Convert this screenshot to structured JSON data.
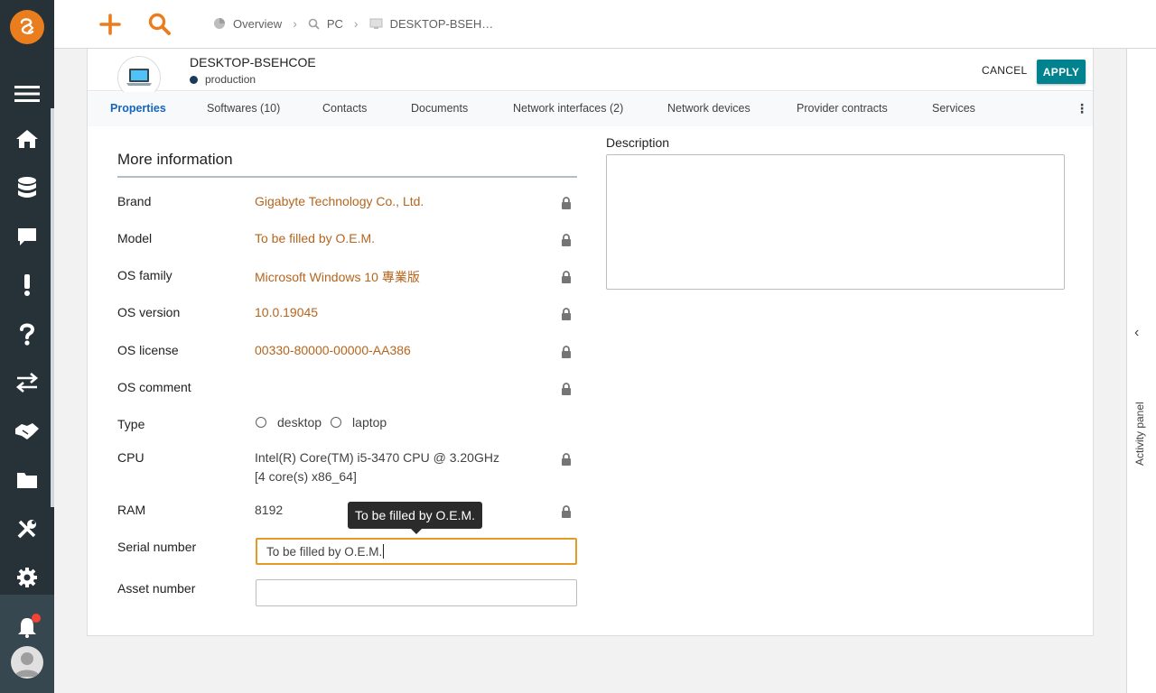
{
  "topbar": {
    "breadcrumb": [
      {
        "label": "Overview",
        "icon": "pie-chart-icon"
      },
      {
        "label": "PC",
        "icon": "search-icon"
      },
      {
        "label": "DESKTOP-BSEH…",
        "icon": "computer-icon"
      }
    ]
  },
  "object": {
    "name": "DESKTOP-BSEHCOE",
    "status": "production",
    "cancel_label": "CANCEL",
    "apply_label": "APPLY"
  },
  "tabs": [
    {
      "label": "Properties",
      "active": true
    },
    {
      "label": "Softwares (10)"
    },
    {
      "label": "Contacts"
    },
    {
      "label": "Documents"
    },
    {
      "label": "Network interfaces (2)"
    },
    {
      "label": "Network devices"
    },
    {
      "label": "Provider contracts"
    },
    {
      "label": "Services"
    }
  ],
  "section": {
    "title": "More information",
    "properties": [
      {
        "label": "Brand",
        "value": "Gigabyte Technology Co., Ltd."
      },
      {
        "label": "Model",
        "value": "To be filled by O.E.M."
      },
      {
        "label": "OS family",
        "value": "Microsoft Windows 10 專業版"
      },
      {
        "label": "OS version",
        "value": "10.0.19045"
      },
      {
        "label": "OS license",
        "value": "00330-80000-00000-AA386"
      },
      {
        "label": "OS comment",
        "value": ""
      },
      {
        "label": "Type",
        "options": [
          "desktop",
          "laptop"
        ]
      },
      {
        "label": "CPU",
        "value_line1": "Intel(R) Core(TM) i5-3470 CPU @ 3.20GHz",
        "value_line2": "[4 core(s) x86_64]"
      },
      {
        "label": "RAM",
        "value": "8192"
      },
      {
        "label": "Serial number",
        "input_value": "To be filled by O.E.M."
      },
      {
        "label": "Asset number",
        "input_value": ""
      }
    ],
    "tooltip": "To be filled by O.E.M."
  },
  "description": {
    "label": "Description",
    "value": ""
  },
  "activity_panel": {
    "label": "Activity panel"
  },
  "colors": {
    "sidebar": "#263238",
    "accent": "#ea7d1e",
    "apply": "#00838f",
    "value_text": "#b5651d",
    "active_tab": "#1565c0",
    "notification": "#f44336"
  }
}
